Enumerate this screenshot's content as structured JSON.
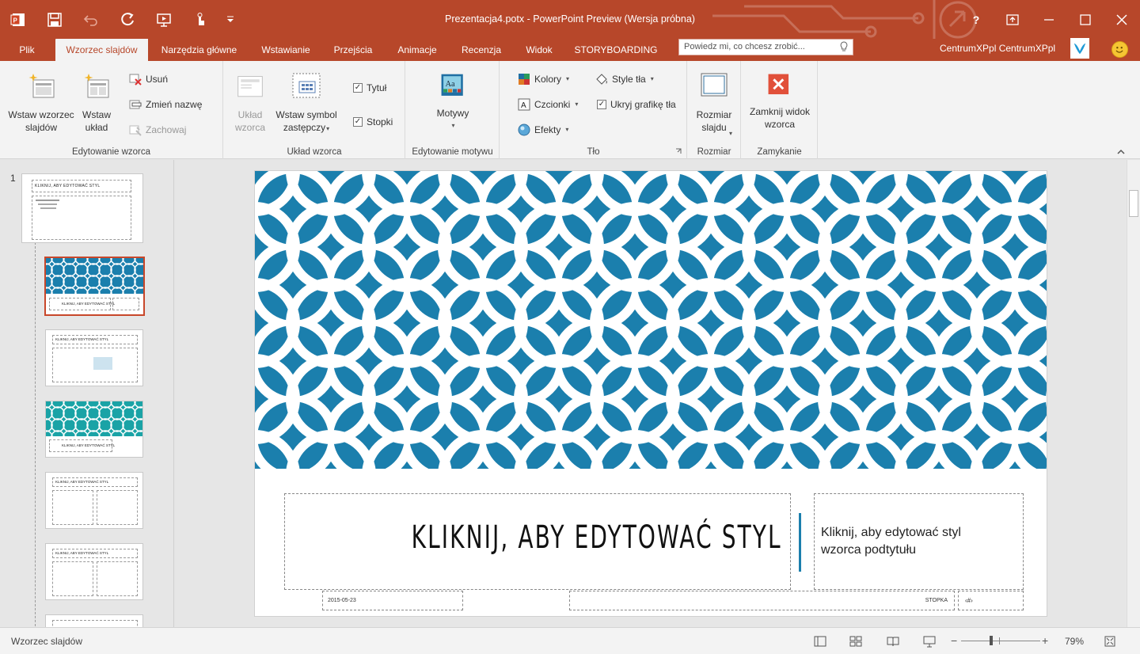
{
  "window": {
    "title": "Prezentacja4.potx - PowerPoint Preview (Wersja próbna)",
    "help": "?",
    "colors": {
      "accent": "#b7472a",
      "ribbon_bg": "#f3f3f3"
    }
  },
  "tabs": [
    {
      "label": "Plik"
    },
    {
      "label": "Wzorzec slajdów"
    },
    {
      "label": "Narzędzia główne"
    },
    {
      "label": "Wstawianie"
    },
    {
      "label": "Przejścia"
    },
    {
      "label": "Animacje"
    },
    {
      "label": "Recenzja"
    },
    {
      "label": "Widok"
    },
    {
      "label": "STORYBOARDING"
    }
  ],
  "tell_me": {
    "placeholder": "Powiedz mi, co chcesz zrobić..."
  },
  "user": {
    "name": "CentrumXPpl CentrumXPpl"
  },
  "ribbon": {
    "edit_master": {
      "label": "Edytowanie wzorca",
      "insert_master": "Wstaw wzorzec slajdów",
      "insert_layout": "Wstaw układ",
      "delete": "Usuń",
      "rename": "Zmień nazwę",
      "preserve": "Zachowaj"
    },
    "master_layout": {
      "label": "Układ wzorca",
      "layout_master": "Układ wzorca",
      "insert_placeholder": "Wstaw symbol zastępczy",
      "title_check": "Tytuł",
      "footers_check": "Stopki"
    },
    "edit_theme": {
      "label": "Edytowanie motywu",
      "themes": "Motywy"
    },
    "background": {
      "label": "Tło",
      "colors": "Kolory",
      "fonts": "Czcionki",
      "effects": "Efekty",
      "bg_styles": "Style tła",
      "hide_bg": "Ukryj grafikę tła"
    },
    "size": {
      "label": "Rozmiar",
      "slide_size": "Rozmiar slajdu"
    },
    "close": {
      "label": "Zamykanie",
      "close_master": "Zamknij widok wzorca"
    }
  },
  "thumbnails": {
    "first_number": "1"
  },
  "slide": {
    "title": "KLIKNIJ, ABY EDYTOWAĆ STYL",
    "subtitle": "Kliknij, aby edytować styl wzorca podtytułu",
    "date": "2015-05-23",
    "footer": "STOPKA",
    "page_number": "‹#›",
    "pattern_color": "#1b7fad"
  },
  "thumb_text": {
    "title": "KLIKNIJ, ABY EDYTOWAĆ STYL"
  },
  "status": {
    "view": "Wzorzec slajdów",
    "zoom": "79%",
    "minus": "−",
    "plus": "+"
  }
}
